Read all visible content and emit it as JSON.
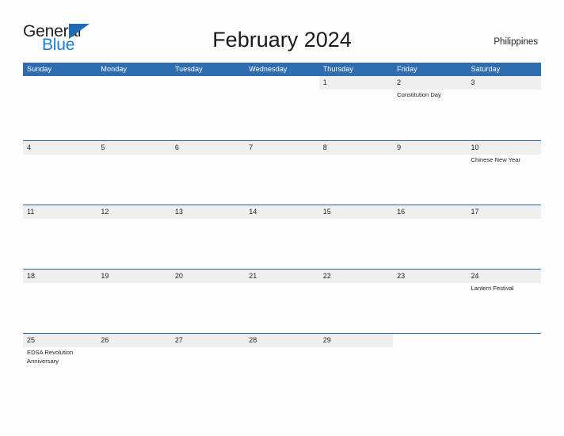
{
  "brand": {
    "name_part1": "General",
    "name_part2": "Blue",
    "flag_icon": "blue-triangle-flag-icon",
    "color_dark": "#231f20",
    "color_blue": "#1b7fd4"
  },
  "header": {
    "title": "February 2024",
    "country": "Philippines"
  },
  "theme": {
    "header_blue": "#2d6db0",
    "row_border_blue": "#2564a8",
    "strip_gray": "#efefef",
    "page_background": "#fdfdfd",
    "text": "#231f20"
  },
  "calendar": {
    "month": "February",
    "year": "2024",
    "weekdays": [
      "Sunday",
      "Monday",
      "Tuesday",
      "Wednesday",
      "Thursday",
      "Friday",
      "Saturday"
    ],
    "weeks": [
      {
        "days": [
          {
            "date": "",
            "events": []
          },
          {
            "date": "",
            "events": []
          },
          {
            "date": "",
            "events": []
          },
          {
            "date": "",
            "events": []
          },
          {
            "date": "1",
            "events": []
          },
          {
            "date": "2",
            "events": [
              "Constitution Day"
            ]
          },
          {
            "date": "3",
            "events": []
          }
        ]
      },
      {
        "days": [
          {
            "date": "4",
            "events": []
          },
          {
            "date": "5",
            "events": []
          },
          {
            "date": "6",
            "events": []
          },
          {
            "date": "7",
            "events": []
          },
          {
            "date": "8",
            "events": []
          },
          {
            "date": "9",
            "events": []
          },
          {
            "date": "10",
            "events": [
              "Chinese New Year"
            ]
          }
        ]
      },
      {
        "days": [
          {
            "date": "11",
            "events": []
          },
          {
            "date": "12",
            "events": []
          },
          {
            "date": "13",
            "events": []
          },
          {
            "date": "14",
            "events": []
          },
          {
            "date": "15",
            "events": []
          },
          {
            "date": "16",
            "events": []
          },
          {
            "date": "17",
            "events": []
          }
        ]
      },
      {
        "days": [
          {
            "date": "18",
            "events": []
          },
          {
            "date": "19",
            "events": []
          },
          {
            "date": "20",
            "events": []
          },
          {
            "date": "21",
            "events": []
          },
          {
            "date": "22",
            "events": []
          },
          {
            "date": "23",
            "events": []
          },
          {
            "date": "24",
            "events": [
              "Lantern Festival"
            ]
          }
        ]
      },
      {
        "days": [
          {
            "date": "25",
            "events": [
              "EDSA Revolution Anniversary"
            ]
          },
          {
            "date": "26",
            "events": []
          },
          {
            "date": "27",
            "events": []
          },
          {
            "date": "28",
            "events": []
          },
          {
            "date": "29",
            "events": []
          },
          {
            "date": "",
            "events": []
          },
          {
            "date": "",
            "events": []
          }
        ]
      }
    ]
  }
}
